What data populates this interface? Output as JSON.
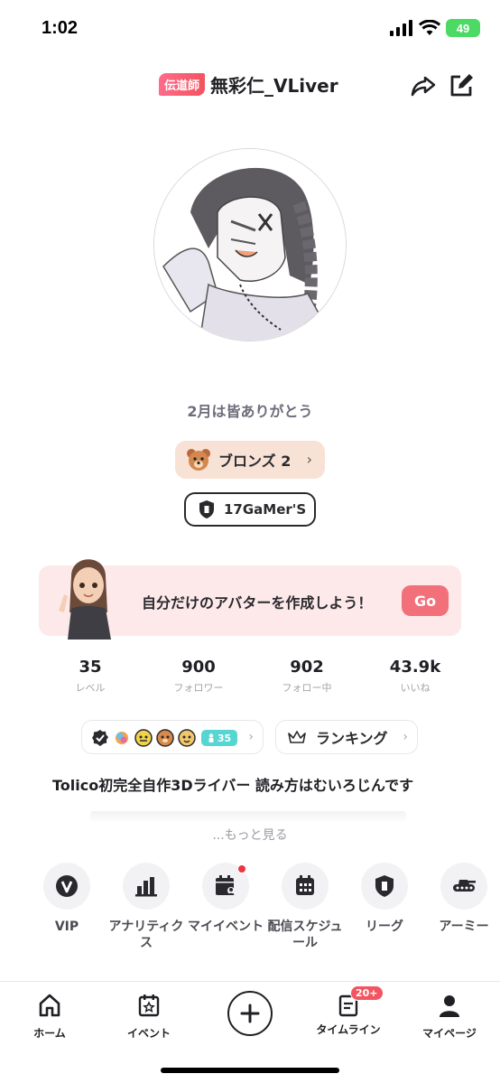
{
  "status_bar": {
    "time": "1:02",
    "battery": "49"
  },
  "header": {
    "badge": "伝道師",
    "username": "無彩仁_VLiver"
  },
  "profile": {
    "tagline": "2月は皆ありがとう",
    "rank_label": "ブロンズ 2",
    "army_label": "17GaMer'S"
  },
  "banner": {
    "text": "自分だけのアバターを作成しよう！",
    "button": "Go"
  },
  "stats": [
    {
      "value": "35",
      "label": "レベル"
    },
    {
      "value": "900",
      "label": "フォロワー"
    },
    {
      "value": "902",
      "label": "フォロー中"
    },
    {
      "value": "43.9k",
      "label": "いいね"
    }
  ],
  "badges": {
    "level_badge": "35"
  },
  "ranking_label": "ランキング",
  "bio": "Tolico初完全自作3Dライバー 読み方はむいろじんです",
  "more_label": "...もっと見る",
  "menu": [
    {
      "label": "VIP",
      "icon": "vip-icon"
    },
    {
      "label": "アナリティクス",
      "icon": "analytics-icon"
    },
    {
      "label": "マイイベント",
      "icon": "my-event-icon"
    },
    {
      "label": "配信スケジュール",
      "icon": "schedule-icon"
    },
    {
      "label": "リーグ",
      "icon": "league-icon"
    },
    {
      "label": "アーミー",
      "icon": "army-icon"
    }
  ],
  "tabs": [
    {
      "label": "ホーム",
      "icon": "home-icon"
    },
    {
      "label": "イベント",
      "icon": "event-icon"
    },
    {
      "label": "",
      "icon": "plus-icon"
    },
    {
      "label": "タイムライン",
      "icon": "timeline-icon",
      "badge": "20+"
    },
    {
      "label": "マイページ",
      "icon": "person-icon"
    }
  ],
  "colors": {
    "accent": "#f2707a",
    "rank_bg": "#f8e1d5",
    "banner_bg": "#fde9ea",
    "badge_red": "#f2555f"
  }
}
